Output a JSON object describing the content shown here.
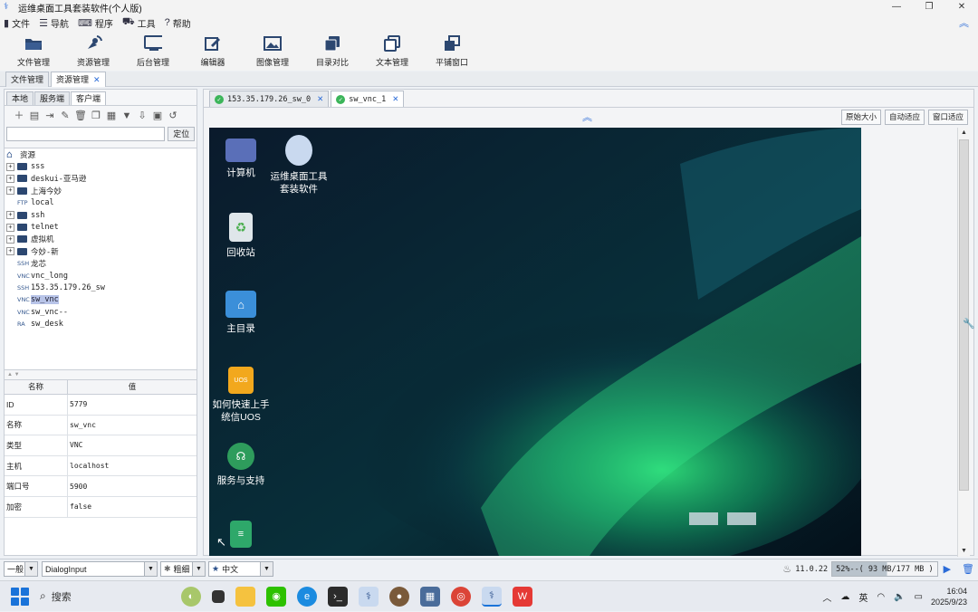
{
  "window": {
    "title": "运维桌面工具套装软件(个人版)"
  },
  "menu": {
    "items": [
      {
        "label": "文件",
        "icon": "file-icon"
      },
      {
        "label": "导航",
        "icon": "list-icon"
      },
      {
        "label": "程序",
        "icon": "keyboard-icon"
      },
      {
        "label": "工具",
        "icon": "car-icon"
      },
      {
        "label": "帮助",
        "icon": "help-icon"
      }
    ]
  },
  "toolbar": {
    "items": [
      {
        "label": "文件管理",
        "icon": "folder-open-icon"
      },
      {
        "label": "资源管理",
        "icon": "satellite-icon"
      },
      {
        "label": "后台管理",
        "icon": "monitor-icon"
      },
      {
        "label": "编辑器",
        "icon": "edit-icon"
      },
      {
        "label": "图像管理",
        "icon": "image-icon"
      },
      {
        "label": "目录对比",
        "icon": "copy-icon"
      },
      {
        "label": "文本管理",
        "icon": "text-copy-icon"
      },
      {
        "label": "平铺窗口",
        "icon": "windows-icon"
      }
    ]
  },
  "main_tabs": [
    {
      "label": "文件管理",
      "active": false,
      "closable": false
    },
    {
      "label": "资源管理",
      "active": true,
      "closable": true
    }
  ],
  "left": {
    "subtabs": [
      {
        "label": "本地",
        "active": false
      },
      {
        "label": "服务端",
        "active": false
      },
      {
        "label": "客户端",
        "active": true
      }
    ],
    "search": {
      "value": "",
      "button": "定位"
    },
    "tree_root": "资源",
    "tree": [
      {
        "label": "sss",
        "kind": "folder"
      },
      {
        "label": "deskui-亚马逊",
        "kind": "folder"
      },
      {
        "label": "上海今妙",
        "kind": "folder"
      },
      {
        "label": "local",
        "kind": "FTP"
      },
      {
        "label": "ssh",
        "kind": "folder"
      },
      {
        "label": "telnet",
        "kind": "folder"
      },
      {
        "label": "虚拟机",
        "kind": "folder"
      },
      {
        "label": "今妙-新",
        "kind": "folder"
      },
      {
        "label": "龙芯",
        "kind": "SSH"
      },
      {
        "label": "vnc_long",
        "kind": "VNC"
      },
      {
        "label": "153.35.179.26_sw",
        "kind": "SSH"
      },
      {
        "label": "sw_vnc",
        "kind": "VNC",
        "selected": true
      },
      {
        "label": "sw_vnc--",
        "kind": "VNC"
      },
      {
        "label": "sw_desk",
        "kind": "RA"
      }
    ],
    "props_header": {
      "name": "名称",
      "value": "值"
    },
    "props": [
      {
        "k": "ID",
        "v": "5779"
      },
      {
        "k": "名称",
        "v": "sw_vnc"
      },
      {
        "k": "类型",
        "v": "VNC"
      },
      {
        "k": "主机",
        "v": "localhost"
      },
      {
        "k": "端口号",
        "v": "5900"
      },
      {
        "k": "加密",
        "v": "false"
      }
    ]
  },
  "sessions": [
    {
      "label": "153.35.179.26_sw_0",
      "active": false
    },
    {
      "label": "sw_vnc_1",
      "active": true
    }
  ],
  "view_buttons": [
    "原始大小",
    "自动适应",
    "窗口适应"
  ],
  "desktop_icons": [
    {
      "label": "计算机",
      "icon": "computer-icon",
      "color": "#5a6fb8"
    },
    {
      "label": "运维桌面工具套装软件",
      "icon": "app-tree-icon",
      "color": "#c9d9ef"
    },
    {
      "label": "回收站",
      "icon": "recycle-bin-icon",
      "color": "#dfe6ea"
    },
    {
      "label": "主目录",
      "icon": "home-folder-icon",
      "color": "#3b8fd9"
    },
    {
      "label": "如何快速上手统信UOS",
      "icon": "uos-guide-icon",
      "color": "#f2a81d"
    },
    {
      "label": "服务与支持",
      "icon": "support-icon",
      "color": "#2e9c5c"
    },
    {
      "label": "",
      "icon": "document-icon",
      "color": "#2ea86a"
    }
  ],
  "status": {
    "mode": "一般",
    "font": "DialogInput",
    "style": "粗细",
    "lang": "中文",
    "version": "11.0.22",
    "memory": "52%--( 93 MB/177 MB )",
    "memory_pct": 52
  },
  "taskbar": {
    "search": "搜索",
    "apps": [
      "widgets-icon",
      "taskview-icon",
      "explorer-icon",
      "wechat-icon",
      "edge-icon",
      "terminal-icon",
      "tool-icon",
      "game-icon",
      "network-icon",
      "chrome-icon",
      "app-active-icon",
      "wps-icon"
    ],
    "tray_ime": "英",
    "time": "16:04",
    "date": "2025/9/23"
  }
}
